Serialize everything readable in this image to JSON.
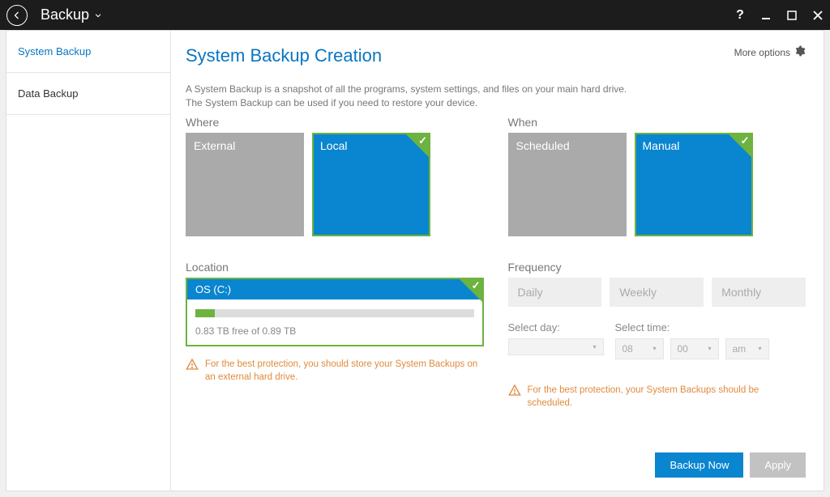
{
  "titlebar": {
    "title": "Backup"
  },
  "sidebar": {
    "items": [
      {
        "label": "System Backup",
        "active": true
      },
      {
        "label": "Data Backup",
        "active": false
      }
    ]
  },
  "header": {
    "page_title": "System Backup Creation",
    "more_options": "More options"
  },
  "description": {
    "line1": "A System Backup is a snapshot of all the programs, system settings, and files on your main hard drive.",
    "line2": "The System Backup can be used if you need to restore your device."
  },
  "where": {
    "label": "Where",
    "tiles": [
      {
        "label": "External",
        "selected": false
      },
      {
        "label": "Local",
        "selected": true
      }
    ]
  },
  "when": {
    "label": "When",
    "tiles": [
      {
        "label": "Scheduled",
        "selected": false
      },
      {
        "label": "Manual",
        "selected": true
      }
    ]
  },
  "location": {
    "label": "Location",
    "drive": "OS (C:)",
    "free_text": "0.83 TB free of 0.89 TB",
    "used_percent": 7,
    "warning": "For the best protection, you should store your System Backups on an external hard drive."
  },
  "frequency": {
    "label": "Frequency",
    "options": [
      "Daily",
      "Weekly",
      "Monthly"
    ],
    "select_day_label": "Select day:",
    "select_day_value": "",
    "select_time_label": "Select time:",
    "hour": "08",
    "minute": "00",
    "ampm": "am",
    "warning": "For the best protection, your System Backups should be scheduled."
  },
  "buttons": {
    "backup_now": "Backup Now",
    "apply": "Apply"
  }
}
